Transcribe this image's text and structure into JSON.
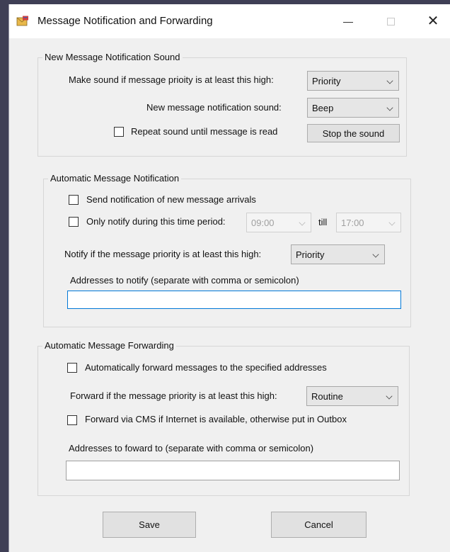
{
  "window": {
    "title": "Message Notification and Forwarding",
    "close_glyph": "✕"
  },
  "sound_group": {
    "title": "New Message Notification Sound",
    "priority_label": "Make sound if message prioity is at least this high:",
    "priority_value": "Priority",
    "sound_label": "New message notification sound:",
    "sound_value": "Beep",
    "repeat_label": "Repeat sound until message is read",
    "repeat_checked": false,
    "stop_button": "Stop the sound"
  },
  "notify_group": {
    "title": "Automatic Message Notification",
    "send_label": "Send notification of new message arrivals",
    "send_checked": false,
    "period_label": "Only notify during this time period:",
    "period_checked": false,
    "start_time": "09:00",
    "till_label": "till",
    "end_time": "17:00",
    "priority_label": "Notify if the message priority is at least this high:",
    "priority_value": "Priority",
    "addresses_label": "Addresses to notify (separate with comma or semicolon)",
    "addresses_value": ""
  },
  "forward_group": {
    "title": "Automatic Message Forwarding",
    "auto_label": "Automatically forward messages to the specified addresses",
    "auto_checked": false,
    "priority_label": "Forward if the message priority is at least this high:",
    "priority_value": "Routine",
    "cms_label": "Forward via CMS if Internet is available, otherwise put in Outbox",
    "cms_checked": false,
    "addresses_label": "Addresses to foward to (separate with comma or semicolon)",
    "addresses_value": ""
  },
  "footer": {
    "save_label": "Save",
    "cancel_label": "Cancel"
  },
  "icons": {
    "app": "envelope-app-icon",
    "minimize": "minimize-icon",
    "maximize": "maximize-icon",
    "close": "close-icon",
    "dropdown": "chevron-down-icon"
  },
  "colors": {
    "window_bg": "#f0f0f0",
    "titlebar_bg": "#ffffff",
    "focus_border": "#0078d7",
    "desktop_bg": "#3f3f55"
  }
}
